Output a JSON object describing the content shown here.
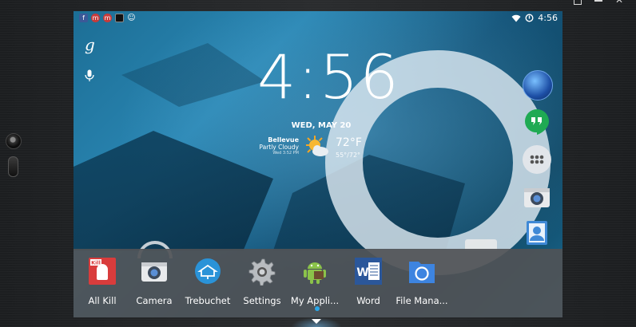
{
  "status_bar": {
    "time": "4:56",
    "notification_icons": [
      "facebook-icon",
      "mail-m-icon",
      "mail-m-icon",
      "app-square-icon",
      "cat-icon"
    ],
    "status_icons": [
      "wifi-icon",
      "sync-icon"
    ]
  },
  "lockscreen": {
    "clock": "4:56",
    "date": "WED, MAY 20",
    "weather": {
      "city": "Bellevue",
      "condition": "Partly Cloudy",
      "updated": "Wed 3:52 PM",
      "temperature": "72°F",
      "range": "55°/72°",
      "icon": "partly-sunny-icon"
    }
  },
  "search": {
    "google_glyph": "g",
    "mic_icon": "mic-icon"
  },
  "right_dock": [
    "earth-icon",
    "hangouts-icon",
    "app-drawer-icon",
    "camera-icon",
    "contacts-icon"
  ],
  "tray_apps": [
    {
      "label": "All Kill",
      "icon": "all-kill-icon",
      "badge": "Kill"
    },
    {
      "label": "Camera",
      "icon": "camera-icon"
    },
    {
      "label": "Trebuchet",
      "icon": "trebuchet-icon"
    },
    {
      "label": "Settings",
      "icon": "gear-icon"
    },
    {
      "label": "My Appli...",
      "icon": "android-icon"
    },
    {
      "label": "Word",
      "icon": "word-icon",
      "badge": "W"
    },
    {
      "label": "File Mana...",
      "icon": "file-manager-icon"
    }
  ],
  "colors": {
    "accent": "#2aa7e8",
    "wallpaper_blue": "#1c6e95",
    "tray": "#505256"
  }
}
